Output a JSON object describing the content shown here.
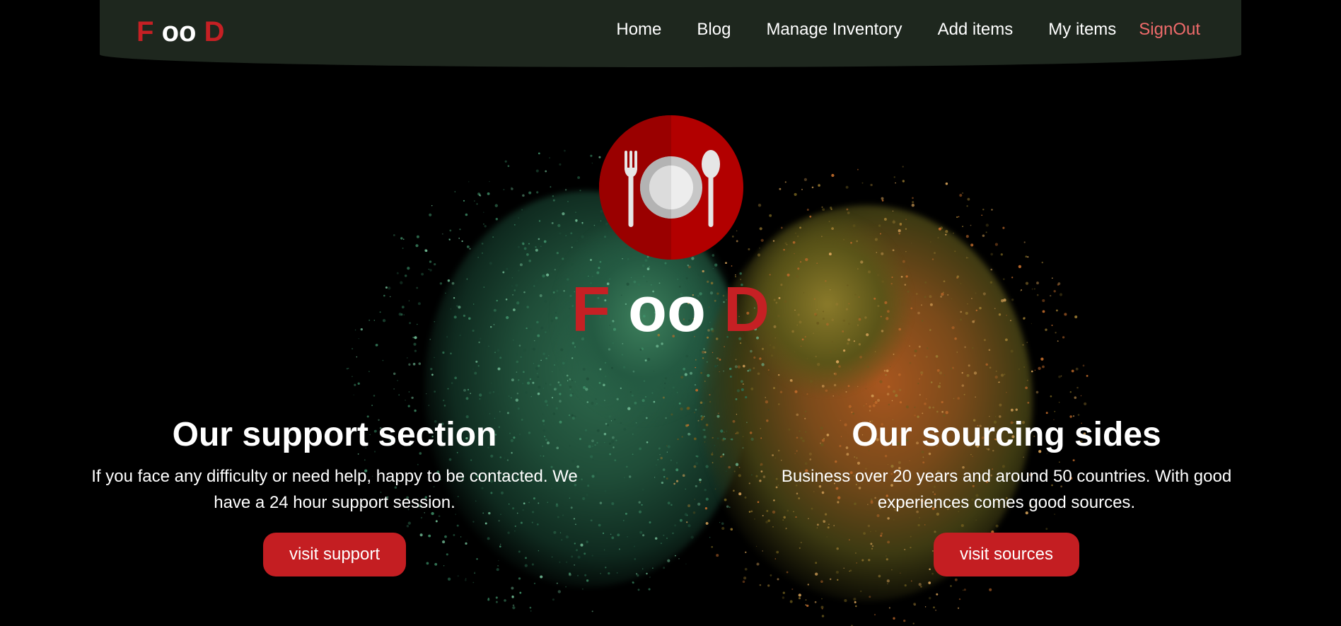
{
  "navbar": {
    "brand": {
      "first": "F",
      "middle": "oo",
      "last": "D"
    },
    "links": [
      {
        "label": "Home"
      },
      {
        "label": "Blog"
      },
      {
        "label": "Manage Inventory"
      },
      {
        "label": "Add items"
      },
      {
        "label": "My items"
      }
    ],
    "signout_label": "SignOut"
  },
  "hero": {
    "logo_icon": "plate-fork-spoon-icon",
    "brand": {
      "first": "F",
      "middle": "oo",
      "last": "D"
    }
  },
  "sections": {
    "support": {
      "title": "Our support section",
      "text": "If you face any difficulty or need help, happy to be contacted. We have a 24 hour support session.",
      "button_label": "visit support"
    },
    "sourcing": {
      "title": "Our sourcing sides",
      "text": "Business over 20 years and around 50 countries. With good experiences comes good sources.",
      "button_label": "visit sources"
    }
  },
  "colors": {
    "accent_red": "#c62024",
    "navbar_bg": "#1e271e",
    "signout_pink": "#ef6b6b",
    "page_bg": "#000000"
  }
}
